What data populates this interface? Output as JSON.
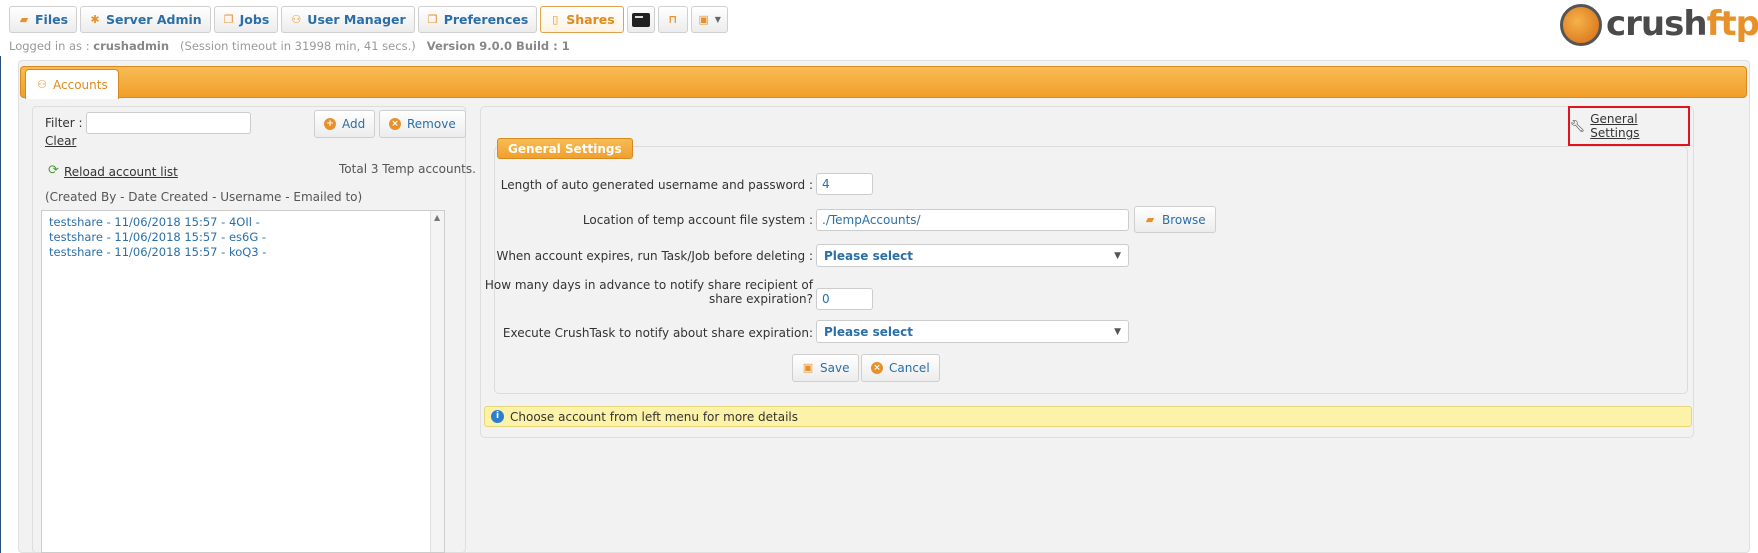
{
  "nav": {
    "files": "Files",
    "server_admin": "Server Admin",
    "jobs": "Jobs",
    "user_manager": "User Manager",
    "preferences": "Preferences",
    "shares": "Shares"
  },
  "session": {
    "logged_in_label": "Logged in as :",
    "username": "crushadmin",
    "timeout": "(Session timeout in 31998 min, 41 secs.)",
    "version": "Version 9.0.0 Build : 1"
  },
  "logo": {
    "part1": "crush",
    "part2": "ftp"
  },
  "tabs": {
    "accounts": "Accounts"
  },
  "left": {
    "filter_label": "Filter :",
    "filter_value": "",
    "clear_label": "Clear",
    "add_label": "Add",
    "remove_label": "Remove",
    "reload_label": "Reload account list",
    "total_text": "Total 3 Temp accounts.",
    "columns_hint": "(Created By - Date Created - Username - Emailed to)",
    "accounts": [
      "testshare - 11/06/2018 15:57 - 4OIl -",
      "testshare - 11/06/2018 15:57 - es6G -",
      "testshare - 11/06/2018 15:57 - koQ3 -"
    ]
  },
  "settings": {
    "link_label": "General Settings",
    "legend": "General Settings",
    "length_label": "Length of auto generated username and password :",
    "length_value": "4",
    "location_label": "Location of temp account file system :",
    "location_value": "./TempAccounts/",
    "browse_label": "Browse",
    "expire_task_label": "When account expires, run Task/Job before deleting :",
    "expire_task_value": "Please select",
    "notify_days_label_1": "How many days in advance to notify share recipient of",
    "notify_days_label_2": "share expiration?",
    "notify_days_value": "0",
    "crushtask_label": "Execute CrushTask to notify about share expiration:",
    "crushtask_value": "Please select",
    "save_label": "Save",
    "cancel_label": "Cancel"
  },
  "info": {
    "message": "Choose account from left menu for more details"
  },
  "colors": {
    "accent": "#f0a030",
    "link": "#2a6fa8",
    "highlight_border": "#e0141e",
    "info_bg": "#fdf3a8"
  }
}
